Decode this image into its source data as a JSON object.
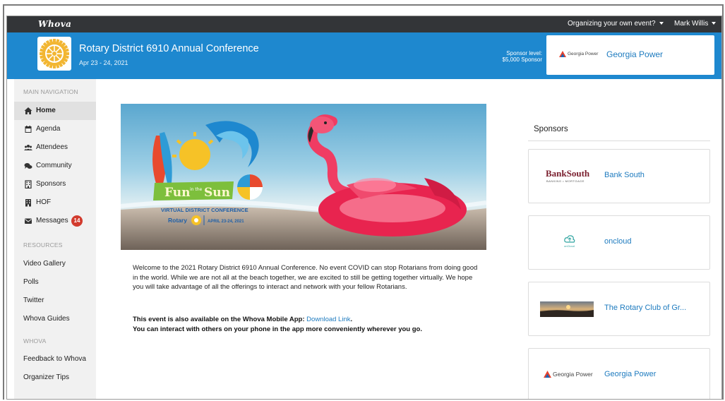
{
  "topbar": {
    "brand": "Whova",
    "organizing": "Organizing your own event?",
    "user": "Mark Willis"
  },
  "header": {
    "title": "Rotary District 6910 Annual Conference",
    "date": "Apr 23 - 24, 2021",
    "sponsor_level_label": "Sponsor level:",
    "sponsor_level_value": "$5,000 Sponsor",
    "sponsor_logo_text": "Georgia Power",
    "sponsor_name": "Georgia Power"
  },
  "sidebar": {
    "main_nav_label": "MAIN NAVIGATION",
    "main_items": [
      {
        "label": "Home",
        "icon": "home-icon",
        "active": true
      },
      {
        "label": "Agenda",
        "icon": "calendar-icon"
      },
      {
        "label": "Attendees",
        "icon": "people-icon"
      },
      {
        "label": "Community",
        "icon": "chat-bubbles-icon"
      },
      {
        "label": "Sponsors",
        "icon": "building-icon"
      },
      {
        "label": "HOF",
        "icon": "bank-icon"
      },
      {
        "label": "Messages",
        "icon": "envelope-icon",
        "badge": "14"
      }
    ],
    "resources_label": "RESOURCES",
    "resources_items": [
      "Video Gallery",
      "Polls",
      "Twitter",
      "Whova Guides"
    ],
    "whova_label": "WHOVA",
    "whova_items": [
      "Feedback to Whova",
      "Organizer Tips"
    ]
  },
  "banner": {
    "fun": "Fun",
    "in_the": "in the",
    "sun": "Sun",
    "subtitle": "VIRTUAL DISTRICT CONFERENCE",
    "rotary": "Rotary",
    "dates": "APRIL 23-24, 2021"
  },
  "main": {
    "welcome": "Welcome to the 2021 Rotary District 6910 Annual Conference.  No event COVID can stop Rotarians from doing good in the world.  While we are not all at the beach together, we are excited to still be getting together virtually.  We hope you will take advantage of all the offerings to interact and network with your fellow Rotarians.",
    "app_line": "This event is also available on the Whova Mobile App: ",
    "download_link": "Download Link",
    "app_line_end": ".",
    "interact_line": "You can interact with others on your phone in the app more conveniently wherever you go."
  },
  "sponsors": {
    "title": "Sponsors",
    "items": [
      {
        "name": "Bank South",
        "logo_text": "BankSouth",
        "logo_sub": "BANKING • MORTGAGE"
      },
      {
        "name": "oncloud",
        "logo_text": "onCloud"
      },
      {
        "name": "The Rotary Club of Gr..."
      },
      {
        "name": "Georgia Power",
        "logo_text": "Georgia Power"
      }
    ]
  },
  "colors": {
    "header_blue": "#1e88cf",
    "topbar": "#333538",
    "link": "#1e7bbf",
    "badge": "#d23b2e"
  }
}
